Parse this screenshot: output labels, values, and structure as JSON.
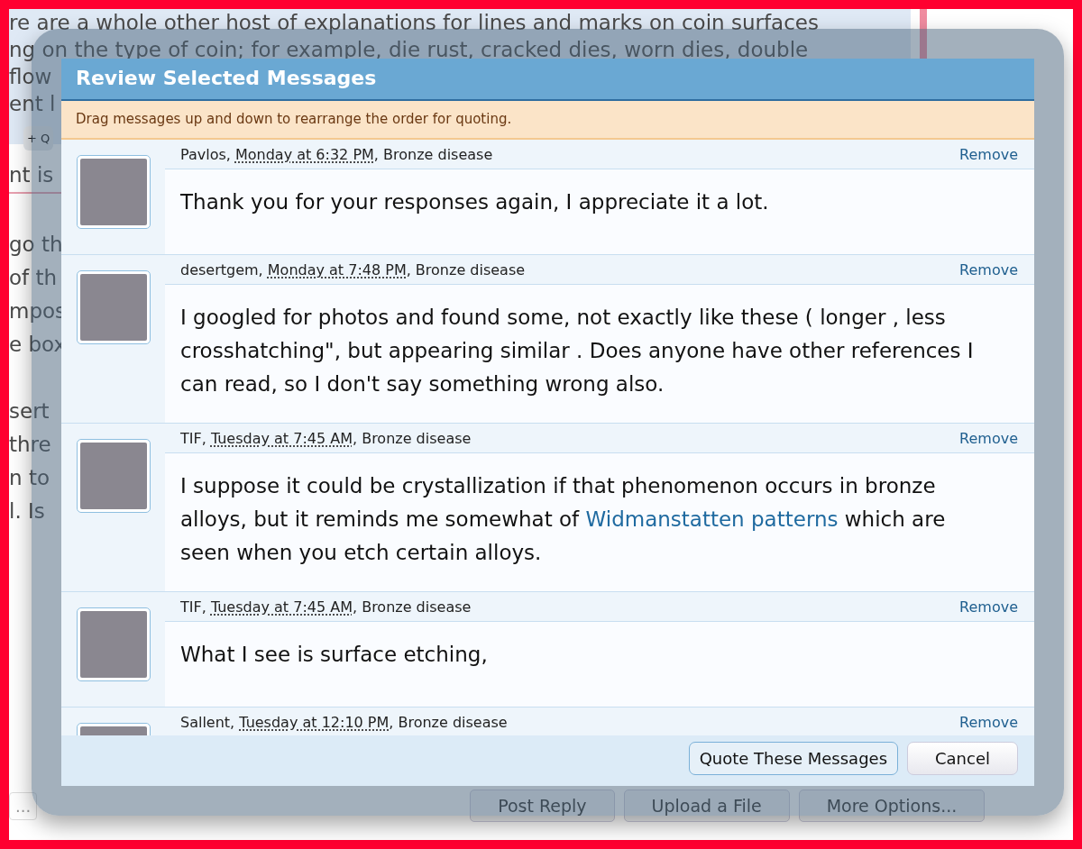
{
  "background_page": {
    "paragraphs": [
      [
        "re are a whole other host of explanations for lines and marks on coin surfaces",
        "ng on the type of coin; for example, die rust, cracked dies, worn dies, double",
        "flow",
        "ent l"
      ],
      [
        "nt is"
      ],
      [
        "go th",
        "of th",
        "mpos",
        "e box"
      ],
      [
        "sert",
        "thre",
        "n to",
        "l.  Is"
      ]
    ],
    "quote_button": "+ Q",
    "toolbar": {
      "more": "...",
      "buttons": [
        "Post Reply",
        "Upload a File",
        "More Options..."
      ]
    }
  },
  "dialog": {
    "title": "Review Selected Messages",
    "notice": "Drag messages up and down to rearrange the order for quoting.",
    "messages": [
      {
        "author": "Pavlos,",
        "date": "Monday at 6:32 PM",
        "thread": ", Bronze disease",
        "remove": "Remove",
        "body": [
          {
            "kind": "text",
            "text": "Thank you for your responses again, I appreciate it a lot."
          }
        ]
      },
      {
        "author": "desertgem,",
        "date": "Monday at 7:48 PM",
        "thread": ", Bronze disease",
        "remove": "Remove",
        "body": [
          {
            "kind": "text",
            "text": "I googled for photos and found some, not exactly like these ( longer , less crosshatching\", but appearing similar . Does anyone have other references I can read, so I don't say something wrong also."
          }
        ]
      },
      {
        "author": "TIF,",
        "date": "Tuesday at 7:45 AM",
        "thread": ", Bronze disease",
        "remove": "Remove",
        "body": [
          {
            "kind": "text",
            "text": "I suppose it could be crystallization if that phenomenon occurs in bronze alloys, but it reminds me somewhat of "
          },
          {
            "kind": "link",
            "text": "Widmanstatten patterns"
          },
          {
            "kind": "text",
            "text": " which are seen when you etch certain alloys."
          }
        ]
      },
      {
        "author": "TIF,",
        "date": "Tuesday at 7:45 AM",
        "thread": ", Bronze disease",
        "remove": "Remove",
        "body": [
          {
            "kind": "text",
            "text": "What I see is surface etching,"
          }
        ]
      },
      {
        "author": "Sallent,",
        "date": "Tuesday at 12:10 PM",
        "thread": ", Bronze disease",
        "remove": "Remove"
      }
    ],
    "buttons": [
      {
        "label": "Quote These Messages",
        "kind": "primary"
      },
      {
        "label": "Cancel",
        "kind": "secondary"
      }
    ]
  }
}
